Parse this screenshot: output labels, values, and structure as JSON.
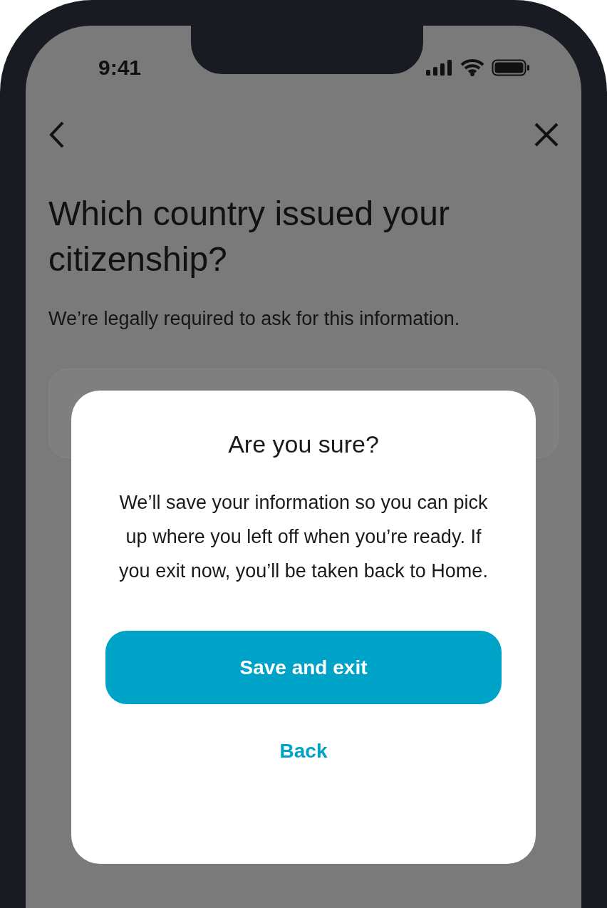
{
  "status_bar": {
    "time": "9:41"
  },
  "page": {
    "title": "Which country issued your citizenship?",
    "subtitle": "We’re legally required to ask for this information."
  },
  "dialog": {
    "title": "Are you sure?",
    "message": "We’ll save your information so you can pick up where you left off when you’re ready. If you exit now, you’ll be taken back to Home.",
    "primary_button": "Save and exit",
    "secondary_button": "Back"
  }
}
